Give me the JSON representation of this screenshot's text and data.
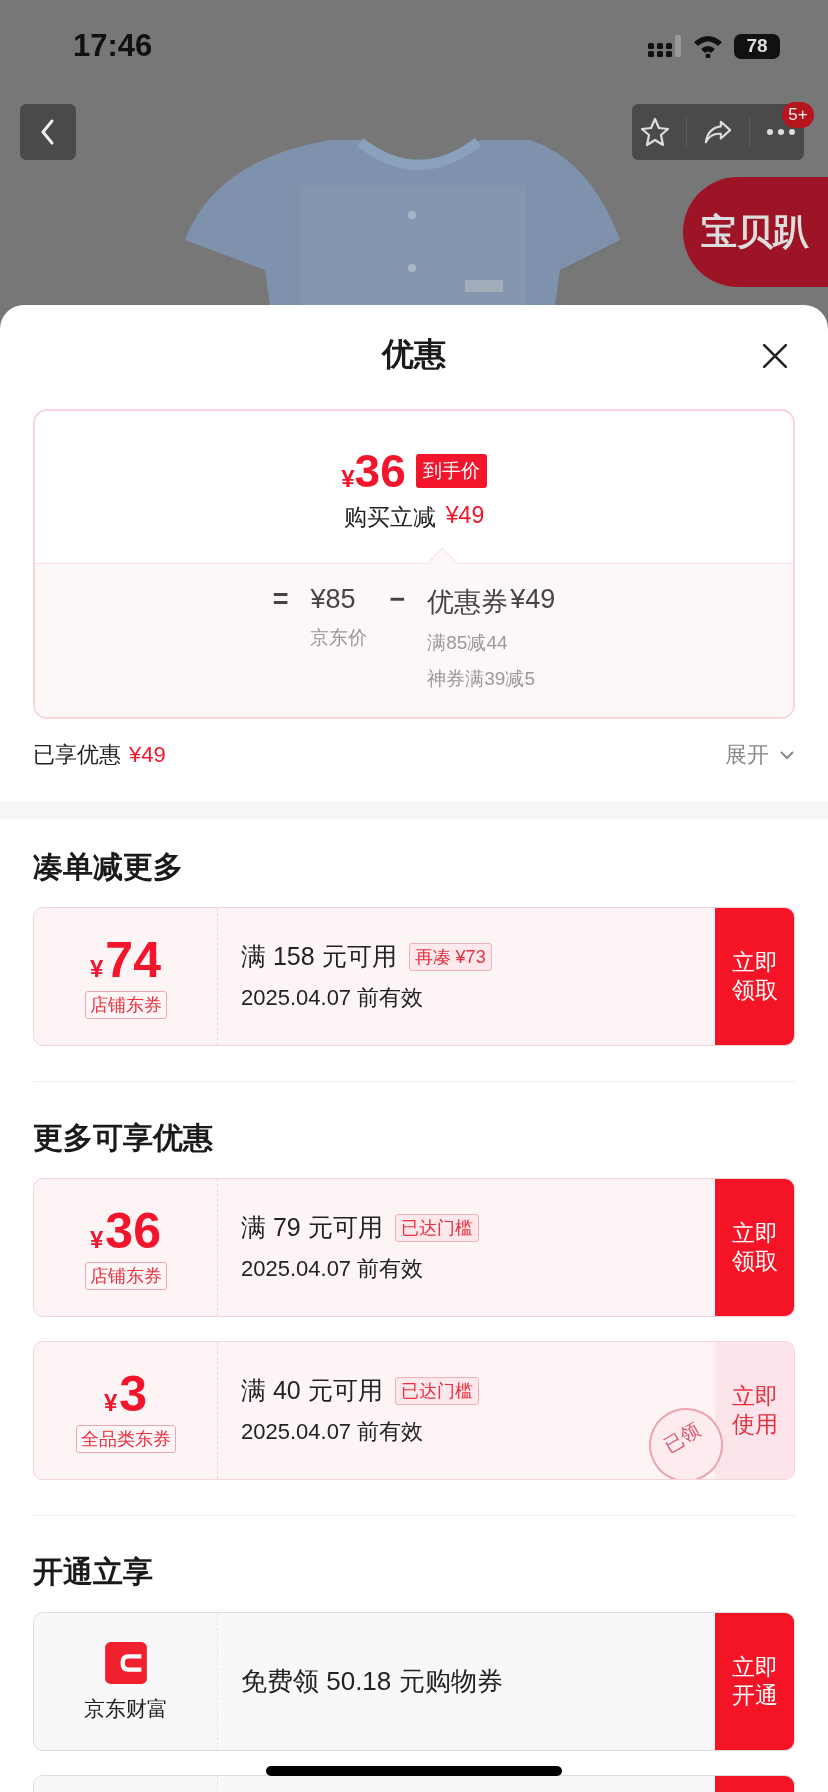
{
  "status_bar": {
    "time": "17:46",
    "battery": "78"
  },
  "header": {
    "badge": "5+",
    "promo_tab": "宝贝趴"
  },
  "sheet": {
    "title": "优惠"
  },
  "summary": {
    "price_symbol": "¥",
    "price": "36",
    "price_tag": "到手价",
    "instant_label": "购买立减",
    "instant_amount": "¥49",
    "equals": "=",
    "base_price": "¥85",
    "base_label": "京东价",
    "minus": "−",
    "coupon_label": "优惠券",
    "coupon_amount": "¥49",
    "coupon_details": [
      "满85减44",
      "神券满39减5"
    ]
  },
  "enjoyed": {
    "label": "已享优惠",
    "amount": "¥49",
    "expand": "展开"
  },
  "sections": [
    {
      "title": "凑单减更多",
      "coupons": [
        {
          "kind": "amount",
          "symbol": "¥",
          "amount": "74",
          "type": "店铺东券",
          "condition": "满 158 元可用",
          "tag": "再凑 ¥73",
          "validity": "2025.04.07 前有效",
          "action": "立即领取",
          "claimed": false
        }
      ]
    },
    {
      "title": "更多可享优惠",
      "coupons": [
        {
          "kind": "amount",
          "symbol": "¥",
          "amount": "36",
          "type": "店铺东券",
          "condition": "满 79 元可用",
          "tag": "已达门槛",
          "validity": "2025.04.07 前有效",
          "action": "立即领取",
          "claimed": false
        },
        {
          "kind": "amount",
          "symbol": "¥",
          "amount": "3",
          "type": "全品类东券",
          "condition": "满 40 元可用",
          "tag": "已达门槛",
          "validity": "2025.04.07 前有效",
          "action": "立即使用",
          "claimed": true,
          "stamp": "已领"
        }
      ]
    },
    {
      "title": "开通立享",
      "coupons": [
        {
          "kind": "service",
          "brand": "京东财富",
          "offer": "免费领 50.18 元购物券",
          "action": "立即开通",
          "claimed": false
        },
        {
          "kind": "service",
          "claimed": false
        }
      ]
    }
  ]
}
